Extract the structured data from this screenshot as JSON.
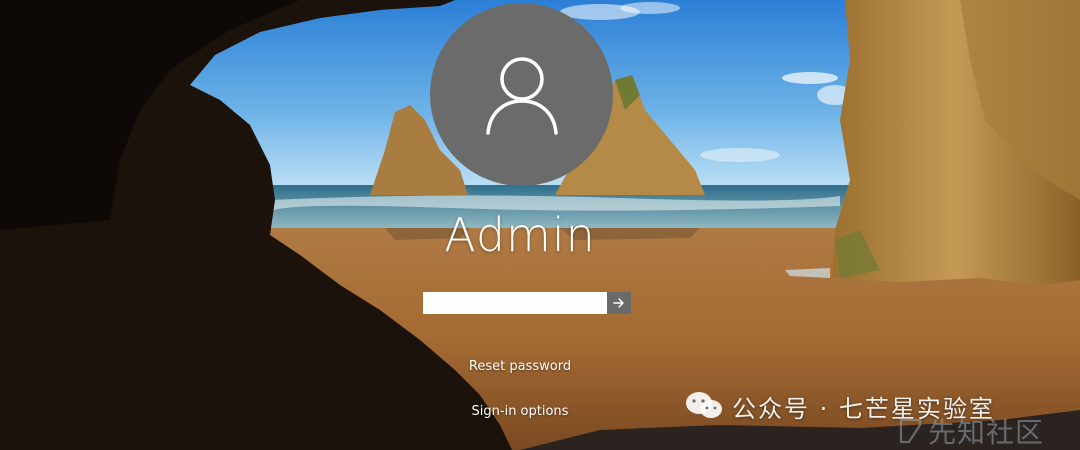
{
  "user": {
    "name": "Admin"
  },
  "password": {
    "value": "",
    "placeholder": ""
  },
  "links": {
    "reset": "Reset password",
    "signin_options": "Sign-in options"
  },
  "icons": {
    "avatar": "user-silhouette-icon",
    "submit": "arrow-right-icon"
  },
  "watermarks": {
    "wechat": "公众号 · 七芒星实验室",
    "site": "先知社区"
  },
  "colors": {
    "avatar_bg": "#6b6b6b",
    "submit_bg": "#6a6a6a",
    "text": "#ffffff"
  }
}
